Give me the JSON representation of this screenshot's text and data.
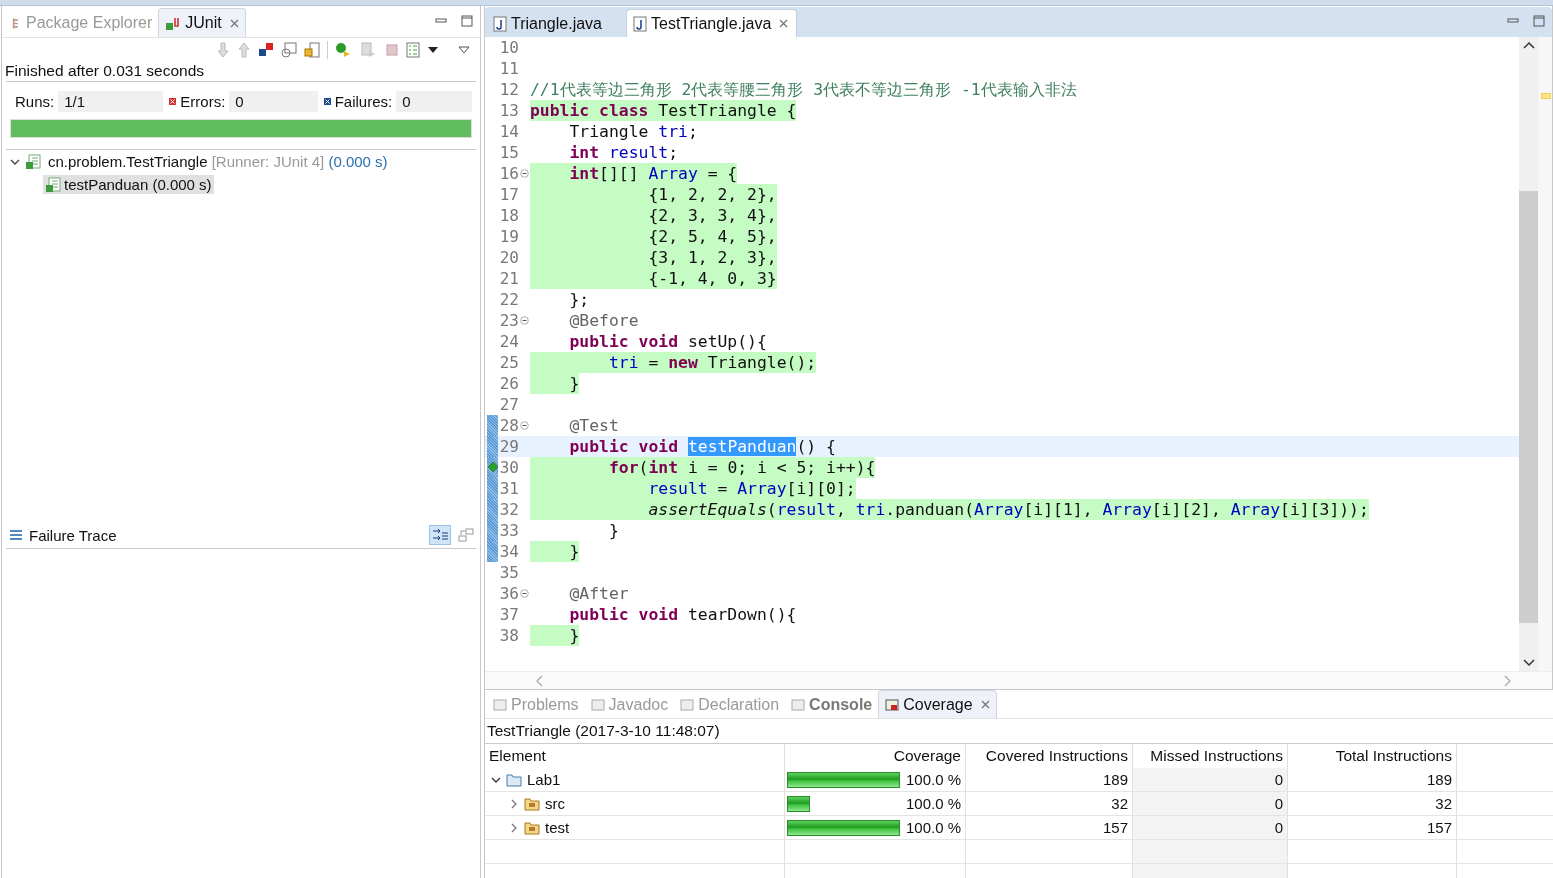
{
  "left_view": {
    "tabs": [
      {
        "label": "Package Explorer",
        "selected": false
      },
      {
        "label": "JUnit",
        "selected": true
      }
    ],
    "status": "Finished after 0.031 seconds",
    "counters": [
      {
        "kind": "runs",
        "label": "Runs:",
        "value": "1/1"
      },
      {
        "kind": "errors",
        "label": "Errors:",
        "value": "0"
      },
      {
        "kind": "failures",
        "label": "Failures:",
        "value": "0"
      }
    ],
    "progress": {
      "level": 1
    },
    "tree": [
      {
        "label": "cn.problem.TestTriangle",
        "runner": "[Runner: JUnit 4]",
        "time": "(0.000 s)",
        "expanded": true,
        "selected": false,
        "children": [
          {
            "label": "testPanduan (0.000 s)",
            "selected": true
          }
        ]
      }
    ],
    "failure_trace": {
      "title": "Failure Trace"
    }
  },
  "editor": {
    "tabs": [
      {
        "label": "Triangle.java",
        "selected": false
      },
      {
        "label": "TestTriangle.java",
        "selected": true
      }
    ],
    "lines": [
      {
        "n": "10"
      },
      {
        "n": "11"
      },
      {
        "n": "12",
        "covered": false,
        "tokens": [
          {
            "kind": "comment",
            "text": "//1代表等边三角形 2代表等腰三角形 3代表不等边三角形 -1代表输入非法"
          }
        ]
      },
      {
        "n": "13",
        "covered": true,
        "tokens": [
          {
            "kind": "kw",
            "text": "public"
          },
          {
            "kind": "kw",
            "text": " class"
          },
          {
            "kind": "plain",
            "text": " TestTriangle {"
          }
        ]
      },
      {
        "n": "14",
        "covered": false,
        "tokens": [
          {
            "kind": "plain",
            "text": "    Triangle "
          },
          {
            "kind": "field",
            "text": "tri"
          },
          {
            "kind": "plain",
            "text": ";"
          }
        ]
      },
      {
        "n": "15",
        "covered": false,
        "tokens": [
          {
            "kind": "kw",
            "text": "    int"
          },
          {
            "kind": "field",
            "text": " result"
          },
          {
            "kind": "plain",
            "text": ";"
          }
        ]
      },
      {
        "n": "16",
        "covered": true,
        "fold": true,
        "tokens": [
          {
            "kind": "kw",
            "text": "    int"
          },
          {
            "kind": "plain",
            "text": "[][] "
          },
          {
            "kind": "field",
            "text": "Array"
          },
          {
            "kind": "plain",
            "text": " = {"
          }
        ]
      },
      {
        "n": "17",
        "covered": true,
        "tokens": [
          {
            "kind": "plain",
            "text": "            {1, 2, 2, 2},"
          }
        ]
      },
      {
        "n": "18",
        "covered": true,
        "tokens": [
          {
            "kind": "plain",
            "text": "            {2, 3, 3, 4},"
          }
        ]
      },
      {
        "n": "19",
        "covered": true,
        "tokens": [
          {
            "kind": "plain",
            "text": "            {2, 5, 4, 5},"
          }
        ]
      },
      {
        "n": "20",
        "covered": true,
        "tokens": [
          {
            "kind": "plain",
            "text": "            {3, 1, 2, 3},"
          }
        ]
      },
      {
        "n": "21",
        "covered": true,
        "tokens": [
          {
            "kind": "plain",
            "text": "            {-1, 4, 0, 3}"
          }
        ]
      },
      {
        "n": "22",
        "covered": false,
        "tokens": [
          {
            "kind": "plain",
            "text": "    };"
          }
        ]
      },
      {
        "n": "23",
        "covered": false,
        "fold": true,
        "tokens": [
          {
            "kind": "ann",
            "text": "    @Before"
          }
        ]
      },
      {
        "n": "24",
        "covered": false,
        "tokens": [
          {
            "kind": "kw",
            "text": "    public"
          },
          {
            "kind": "kw",
            "text": " void"
          },
          {
            "kind": "plain",
            "text": " setUp(){"
          }
        ]
      },
      {
        "n": "25",
        "covered": true,
        "tokens": [
          {
            "kind": "field",
            "text": "        tri"
          },
          {
            "kind": "plain",
            "text": " = "
          },
          {
            "kind": "kw",
            "text": "new"
          },
          {
            "kind": "plain",
            "text": " Triangle();"
          }
        ]
      },
      {
        "n": "26",
        "covered": true,
        "tokens": [
          {
            "kind": "plain",
            "text": "    }"
          }
        ]
      },
      {
        "n": "27"
      },
      {
        "n": "28",
        "covered": false,
        "fold": true,
        "marked": true,
        "tokens": [
          {
            "kind": "ann",
            "text": "    @Test"
          }
        ]
      },
      {
        "n": "29",
        "covered": false,
        "marked": true,
        "current": true,
        "tokens": [
          {
            "kind": "kw",
            "text": "    public"
          },
          {
            "kind": "kw",
            "text": " void "
          },
          {
            "kind": "sel",
            "text": "testPanduan"
          },
          {
            "kind": "plain",
            "text": "() {"
          }
        ]
      },
      {
        "n": "30",
        "covered": true,
        "marked": true,
        "branch": true,
        "tokens": [
          {
            "kind": "kw",
            "text": "        for"
          },
          {
            "kind": "plain",
            "text": "("
          },
          {
            "kind": "kw",
            "text": "int"
          },
          {
            "kind": "plain",
            "text": " i = 0; i < 5; i++){"
          }
        ]
      },
      {
        "n": "31",
        "covered": true,
        "marked": true,
        "tokens": [
          {
            "kind": "field",
            "text": "            result"
          },
          {
            "kind": "plain",
            "text": " = "
          },
          {
            "kind": "field",
            "text": "Array"
          },
          {
            "kind": "plain",
            "text": "[i][0];"
          }
        ]
      },
      {
        "n": "32",
        "covered": true,
        "marked": true,
        "tokens": [
          {
            "kind": "static",
            "text": "            assertEquals"
          },
          {
            "kind": "plain",
            "text": "("
          },
          {
            "kind": "field",
            "text": "result"
          },
          {
            "kind": "plain",
            "text": ", "
          },
          {
            "kind": "field",
            "text": "tri"
          },
          {
            "kind": "plain",
            "text": ".panduan("
          },
          {
            "kind": "field",
            "text": "Array"
          },
          {
            "kind": "plain",
            "text": "[i][1], "
          },
          {
            "kind": "field",
            "text": "Array"
          },
          {
            "kind": "plain",
            "text": "[i][2], "
          },
          {
            "kind": "field",
            "text": "Array"
          },
          {
            "kind": "plain",
            "text": "[i][3]));"
          }
        ]
      },
      {
        "n": "33",
        "covered": false,
        "marked": true,
        "tokens": [
          {
            "kind": "plain",
            "text": "        }"
          }
        ]
      },
      {
        "n": "34",
        "covered": true,
        "marked": true,
        "tokens": [
          {
            "kind": "plain",
            "text": "    }"
          }
        ]
      },
      {
        "n": "35"
      },
      {
        "n": "36",
        "covered": false,
        "fold": true,
        "tokens": [
          {
            "kind": "ann",
            "text": "    @After"
          }
        ]
      },
      {
        "n": "37",
        "covered": false,
        "tokens": [
          {
            "kind": "kw",
            "text": "    public"
          },
          {
            "kind": "kw",
            "text": " void"
          },
          {
            "kind": "plain",
            "text": " tearDown(){"
          }
        ]
      },
      {
        "n": "38",
        "covered": true,
        "tokens": [
          {
            "kind": "plain",
            "text": "    }"
          }
        ]
      }
    ]
  },
  "bottom_view": {
    "tabs": [
      {
        "label": "Problems",
        "selected": false,
        "bold": false
      },
      {
        "label": "Javadoc",
        "selected": false,
        "bold": false
      },
      {
        "label": "Declaration",
        "selected": false,
        "bold": false
      },
      {
        "label": "Console",
        "selected": false,
        "bold": true
      },
      {
        "label": "Coverage",
        "selected": true,
        "bold": false
      }
    ],
    "session": "TestTriangle (2017-3-10 11:48:07)",
    "columns": [
      "Element",
      "Coverage",
      "Covered Instructions",
      "Missed Instructions",
      "Total Instructions"
    ],
    "rows": [
      {
        "element": "Lab1",
        "kind": "project",
        "expanded": true,
        "level": 1,
        "coverage": "100.0 %",
        "covered": "189",
        "missed": "0",
        "total": "189",
        "children": [
          {
            "element": "src",
            "kind": "folder",
            "expanded": false,
            "level": 0.19,
            "coverage": "100.0 %",
            "covered": "32",
            "missed": "0",
            "total": "32"
          },
          {
            "element": "test",
            "kind": "folder",
            "expanded": false,
            "level": 1,
            "coverage": "100.0 %",
            "covered": "157",
            "missed": "0",
            "total": "157"
          }
        ]
      }
    ]
  }
}
